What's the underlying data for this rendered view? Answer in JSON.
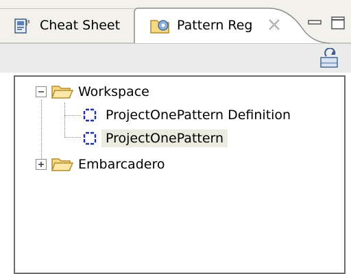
{
  "tabs": [
    {
      "label": "Cheat Sheet",
      "icon": "cheat-sheet-icon",
      "active": false
    },
    {
      "label": "Pattern Reg",
      "icon": "pattern-registry-icon",
      "active": true
    }
  ],
  "tree": {
    "items": [
      {
        "label": "Workspace",
        "icon": "folder-open-icon",
        "expanded": true
      },
      {
        "label": "ProjectOnePattern Definition",
        "icon": "pattern-icon"
      },
      {
        "label": "ProjectOnePattern",
        "icon": "pattern-icon",
        "selected": true
      },
      {
        "label": "Embarcadero",
        "icon": "folder-open-icon",
        "expanded": false
      }
    ]
  },
  "colors": {
    "panel_border": "#6b6b6b",
    "selection": "#ebebdf",
    "tab_bar": "#f2f1ec",
    "toolbar": "#ececec"
  }
}
